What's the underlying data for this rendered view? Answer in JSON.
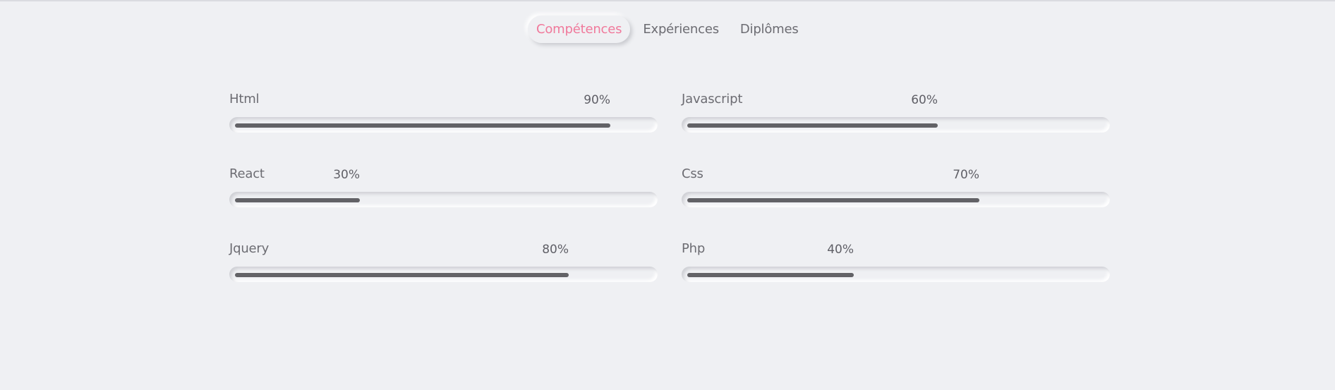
{
  "tabs": [
    {
      "label": "Compétences",
      "active": true
    },
    {
      "label": "Expériences",
      "active": false
    },
    {
      "label": "Diplômes",
      "active": false
    }
  ],
  "skills": [
    {
      "name": "Html",
      "percent_label": "90%",
      "value": 0.9
    },
    {
      "name": "Javascript",
      "percent_label": "60%",
      "value": 0.6
    },
    {
      "name": "React",
      "percent_label": "30%",
      "value": 0.3
    },
    {
      "name": "Css",
      "percent_label": "70%",
      "value": 0.7
    },
    {
      "name": "Jquery",
      "percent_label": "80%",
      "value": 0.8
    },
    {
      "name": "Php",
      "percent_label": "40%",
      "value": 0.4
    }
  ],
  "colors": {
    "accent": "#f0799b",
    "bar": "#626266",
    "background": "#eff0f3"
  }
}
